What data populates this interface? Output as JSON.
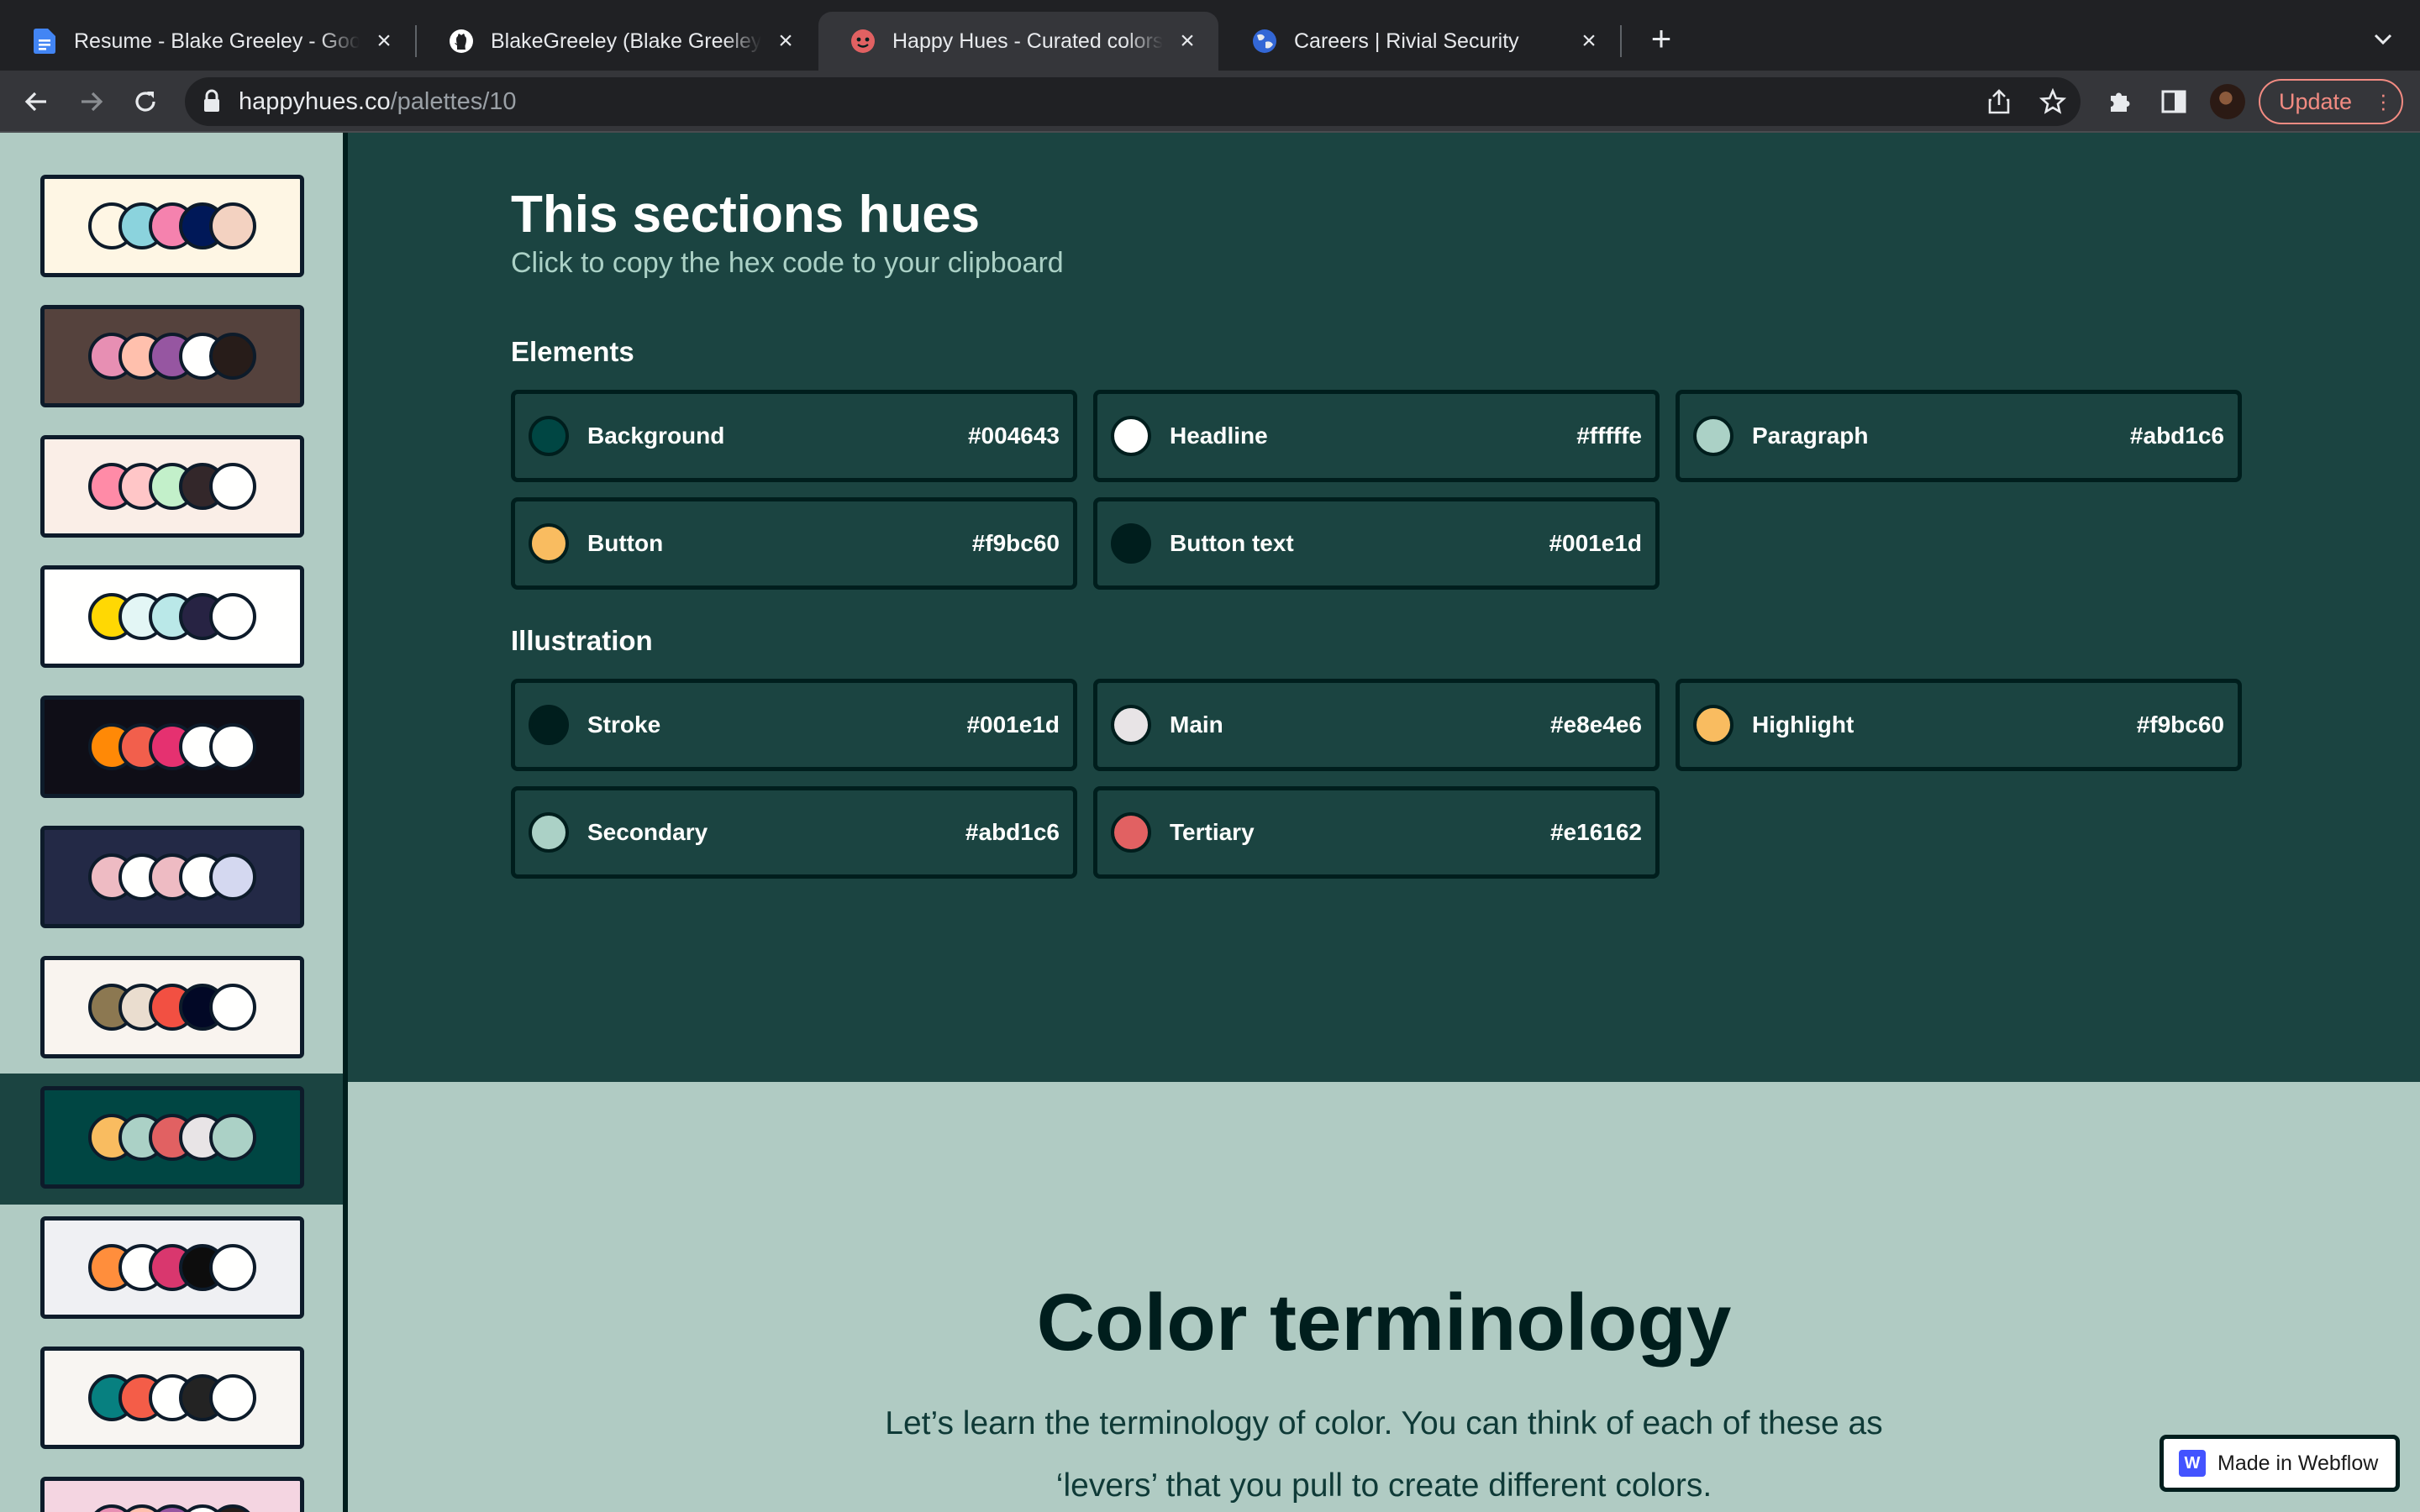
{
  "browser": {
    "tabs": [
      {
        "title": "Resume - Blake Greeley - Google Docs",
        "icon": "google-docs-icon"
      },
      {
        "title": "BlakeGreeley (Blake Greeley)",
        "icon": "github-icon"
      },
      {
        "title": "Happy Hues - Curated colors in context",
        "icon": "happy-hues-icon",
        "active": true
      },
      {
        "title": "Careers | Rivial Security",
        "icon": "rivial-globe-icon"
      }
    ],
    "url_host": "happyhues.co",
    "url_path": "/palettes/10",
    "update_label": "Update"
  },
  "sidebar": {
    "palettes": [
      {
        "bg": "#fef6e4",
        "colors": [
          "#fef6e4",
          "#8bd3dd",
          "#f582ae",
          "#001858",
          "#f3d2c1"
        ]
      },
      {
        "bg": "#55423d",
        "colors": [
          "#e78fb3",
          "#ffc0ad",
          "#9656a1",
          "#fffffe",
          "#271c19"
        ]
      },
      {
        "bg": "#faeee7",
        "colors": [
          "#ff8ba7",
          "#ffc6c7",
          "#c3f0ca",
          "#33272a",
          "#fffffe"
        ]
      },
      {
        "bg": "#fffffe",
        "colors": [
          "#ffd803",
          "#e3f6f5",
          "#bae8e8",
          "#272343",
          "#fffffe"
        ]
      },
      {
        "bg": "#0f0e17",
        "colors": [
          "#ff8906",
          "#f25f4c",
          "#e53170",
          "#fffffe",
          "#fffffe"
        ]
      },
      {
        "bg": "#232946",
        "colors": [
          "#eebbc3",
          "#fffffe",
          "#eebbc3",
          "#fffffe",
          "#d4d8f0"
        ]
      },
      {
        "bg": "#f9f4ef",
        "colors": [
          "#8c7851",
          "#eaddcf",
          "#f25042",
          "#020826",
          "#fffffe"
        ]
      },
      {
        "bg": "#004643",
        "colors": [
          "#f9bc60",
          "#abd1c6",
          "#e16162",
          "#e8e4e6",
          "#abd1c6"
        ]
      },
      {
        "bg": "#eff0f3",
        "colors": [
          "#ff8e3c",
          "#fffffe",
          "#d9376e",
          "#0d0d0d",
          "#fffffe"
        ]
      },
      {
        "bg": "#f8f5f2",
        "colors": [
          "#078080",
          "#f45d48",
          "#fffffe",
          "#232323",
          "#fffffe"
        ]
      },
      {
        "bg": "#f4d5e1",
        "colors": [
          "#e78fb3",
          "#ffc0ad",
          "#9656a1",
          "#fffffe",
          "#271c19"
        ]
      }
    ]
  },
  "hues": {
    "title": "This sections hues",
    "subtitle": "Click to copy the hex code to your clipboard",
    "elements_label": "Elements",
    "elements": [
      {
        "name": "Background",
        "hex": "#004643"
      },
      {
        "name": "Headline",
        "hex": "#fffffe"
      },
      {
        "name": "Paragraph",
        "hex": "#abd1c6"
      },
      {
        "name": "Button",
        "hex": "#f9bc60"
      },
      {
        "name": "Button text",
        "hex": "#001e1d"
      }
    ],
    "illustration_label": "Illustration",
    "illustration": [
      {
        "name": "Stroke",
        "hex": "#001e1d"
      },
      {
        "name": "Main",
        "hex": "#e8e4e6"
      },
      {
        "name": "Highlight",
        "hex": "#f9bc60"
      },
      {
        "name": "Secondary",
        "hex": "#abd1c6"
      },
      {
        "name": "Tertiary",
        "hex": "#e16162"
      }
    ]
  },
  "terminology": {
    "title": "Color terminology",
    "paragraph": "Let’s learn the terminology of color. You can think of each of these as ‘levers’ that you pull to create different colors."
  },
  "webflow_badge": "Made in Webflow"
}
